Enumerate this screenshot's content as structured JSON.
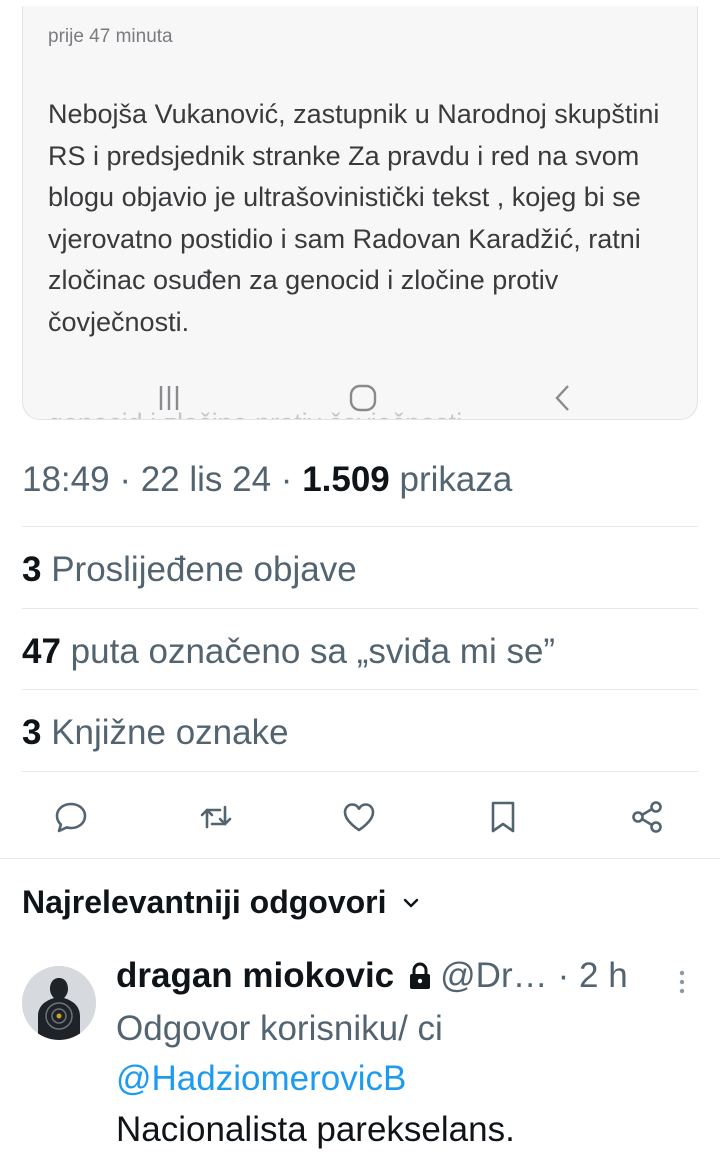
{
  "embedded_post": {
    "time": "prije 47 minuta",
    "text": "Nebojša Vukanović, zastupnik u Narodnoj skupštini RS i predsjednik stranke Za pravdu i red na svom blogu objavio je ultrašovinistički tekst , kojeg bi se vjerovatno postidio i sam Radovan Karadžić, ratni zločinac osuđen za genocid i zločine protiv čovječnosti.",
    "ghost_text": "genocid i zločine protiv čovječnosti.",
    "nav": {
      "recent_icon": "recent-apps-icon",
      "home_icon": "home-icon",
      "back_icon": "back-icon"
    }
  },
  "post_meta": {
    "time": "18:49",
    "sep1": " · ",
    "date": "22 lis 24",
    "sep2": " · ",
    "views_count": "1.509",
    "views_label": " prikaza"
  },
  "stats": {
    "reposts": {
      "count": "3",
      "label": " Proslijeđene objave"
    },
    "likes": {
      "count": "47",
      "label": " puta označeno sa „sviđa mi se”"
    },
    "bookmarks": {
      "count": "3",
      "label": " Knjižne oznake"
    }
  },
  "actions": [
    "reply-icon",
    "repost-icon",
    "like-icon",
    "bookmark-icon",
    "share-icon"
  ],
  "replies": {
    "heading": "Najrelevantniji odgovori",
    "items": [
      {
        "name": "dragan miokovic",
        "handle": "@Dr…",
        "time_sep": " · ",
        "time": "2 h",
        "reply_to_label": "Odgovor korisniku/ ci ",
        "reply_to_mention": "@HadziomerovicB",
        "text": "Nacionalista parekselans."
      }
    ]
  },
  "colors": {
    "text": "#0f1419",
    "secondary": "#536471",
    "accent": "#1d9bf0",
    "divider": "#e6e9ec"
  }
}
